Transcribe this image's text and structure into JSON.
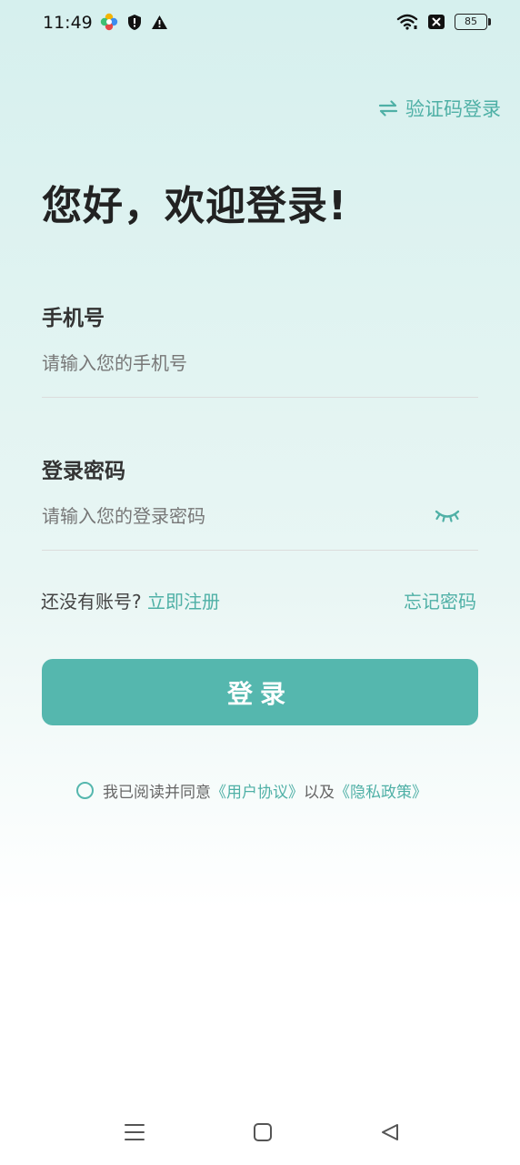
{
  "status_bar": {
    "time": "11:49",
    "battery": "85",
    "icons_left": [
      "pinwheel-app-icon",
      "shield-icon",
      "warning-icon"
    ],
    "icons_right": [
      "wifi-icon",
      "sim-blocked-icon",
      "battery-icon"
    ]
  },
  "header": {
    "switch_login_label": "验证码登录",
    "welcome_title": "您好，欢迎登录!"
  },
  "form": {
    "phone_label": "手机号",
    "phone_placeholder": "请输入您的手机号",
    "phone_value": "",
    "password_label": "登录密码",
    "password_placeholder": "请输入您的登录密码",
    "password_value": ""
  },
  "links": {
    "no_account_text": "还没有账号?",
    "register_label": "立即注册",
    "forgot_label": "忘记密码"
  },
  "actions": {
    "login_label": "登录"
  },
  "agreement": {
    "prefix": "我已阅读并同意",
    "user_agreement": "《用户协议》",
    "conjunction": "以及",
    "privacy_policy": "《隐私政策》"
  },
  "colors": {
    "accent": "#55b7ae",
    "link": "#4fb0a6",
    "title": "#222222"
  }
}
